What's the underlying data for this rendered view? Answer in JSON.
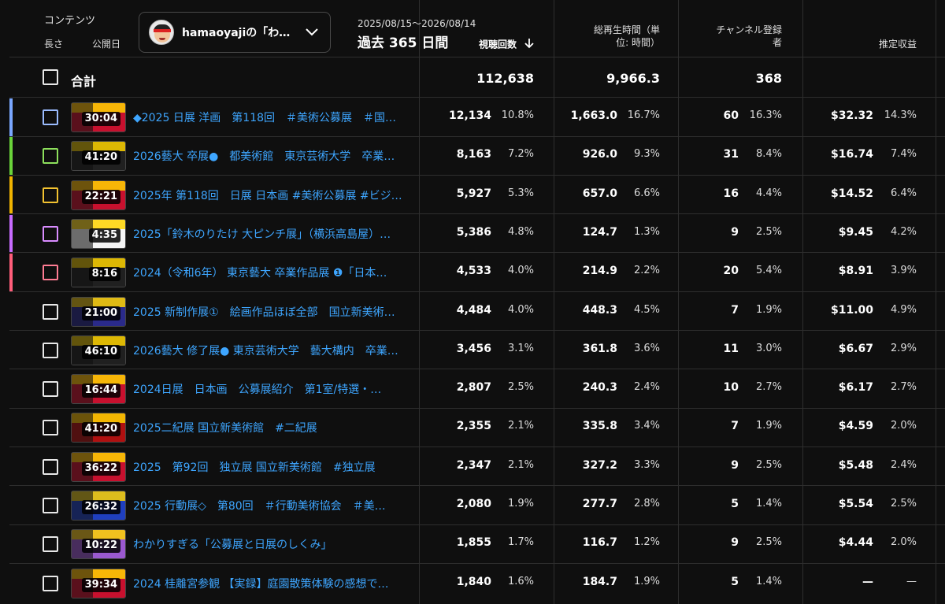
{
  "header": {
    "content_label": "コンテンツ",
    "length_label": "長さ",
    "published_label": "公開日",
    "channel_name": "hamaoyajiの「わ…",
    "date_range": "2025/08/15〜2026/08/14",
    "period": "過去 365 日間",
    "columns": {
      "views": "視聴回数",
      "watch_time_line1": "総再生時間（単",
      "watch_time_line2": "位: 時間）",
      "subs_line1": "チャンネル登録",
      "subs_line2": "者",
      "revenue": "推定収益"
    }
  },
  "totals": {
    "label": "合計",
    "views": "112,638",
    "watch_time": "9,966.3",
    "subscribers": "368",
    "revenue": ""
  },
  "colors": {
    "accent_link": "#3ea6ff",
    "background": "#0f0f0f"
  },
  "rows": [
    {
      "bar": "#7aa7ff",
      "box": "#9bbcff",
      "thumb": "#c8102e",
      "duration": "30:04",
      "title": "◆2025 日展 洋画　第118回　＃美術公募展　＃国…",
      "views": "12,134",
      "views_pct": "10.8%",
      "watch": "1,663.0",
      "watch_pct": "16.7%",
      "subs": "60",
      "subs_pct": "16.3%",
      "rev": "$32.32",
      "rev_pct": "14.3%"
    },
    {
      "bar": "#6ad43a",
      "box": "#8de05c",
      "thumb": "#202020",
      "duration": "41:20",
      "title": "2026藝大 卒展●　都美術館　東京芸術大学　卒業…",
      "views": "8,163",
      "views_pct": "7.2%",
      "watch": "926.0",
      "watch_pct": "9.3%",
      "subs": "31",
      "subs_pct": "8.4%",
      "rev": "$16.74",
      "rev_pct": "7.4%"
    },
    {
      "bar": "#f0b400",
      "box": "#f2c230",
      "thumb": "#c8102e",
      "duration": "22:21",
      "title": "2025年 第118回　日展 日本画 #美術公募展 #ビジ…",
      "views": "5,927",
      "views_pct": "5.3%",
      "watch": "657.0",
      "watch_pct": "6.6%",
      "subs": "16",
      "subs_pct": "4.4%",
      "rev": "$14.52",
      "rev_pct": "6.4%"
    },
    {
      "bar": "#c86bff",
      "box": "#d98cff",
      "thumb": "#f5f5f5",
      "duration": "4:35",
      "title": "2025「鈴木のりたけ 大ピンチ展」（横浜高島屋）…",
      "views": "5,386",
      "views_pct": "4.8%",
      "watch": "124.7",
      "watch_pct": "1.3%",
      "subs": "9",
      "subs_pct": "2.5%",
      "rev": "$9.45",
      "rev_pct": "4.2%"
    },
    {
      "bar": "#ff5d7a",
      "box": "#ff7c93",
      "thumb": "#202020",
      "duration": "8:16",
      "title": "2024（令和6年） 東京藝大 卒業作品展 ❶「日本…",
      "views": "4,533",
      "views_pct": "4.0%",
      "watch": "214.9",
      "watch_pct": "2.2%",
      "subs": "20",
      "subs_pct": "5.4%",
      "rev": "$8.91",
      "rev_pct": "3.9%"
    },
    {
      "bar": "",
      "box": "#e8e8e8",
      "thumb": "#2a2a8a",
      "duration": "21:00",
      "title": "2025 新制作展①　絵画作品ほぼ全部　国立新美術…",
      "views": "4,484",
      "views_pct": "4.0%",
      "watch": "448.3",
      "watch_pct": "4.5%",
      "subs": "7",
      "subs_pct": "1.9%",
      "rev": "$11.00",
      "rev_pct": "4.9%"
    },
    {
      "bar": "",
      "box": "#e8e8e8",
      "thumb": "#202020",
      "duration": "46:10",
      "title": "2026藝大 修了展● 東京芸術大学　藝大構内　卒業…",
      "views": "3,456",
      "views_pct": "3.1%",
      "watch": "361.8",
      "watch_pct": "3.6%",
      "subs": "11",
      "subs_pct": "3.0%",
      "rev": "$6.67",
      "rev_pct": "2.9%"
    },
    {
      "bar": "",
      "box": "#e8e8e8",
      "thumb": "#c8102e",
      "duration": "16:44",
      "title": "2024日展　日本画　公募展紹介　第1室/特選・…",
      "views": "2,807",
      "views_pct": "2.5%",
      "watch": "240.3",
      "watch_pct": "2.4%",
      "subs": "10",
      "subs_pct": "2.7%",
      "rev": "$6.17",
      "rev_pct": "2.7%"
    },
    {
      "bar": "",
      "box": "#e8e8e8",
      "thumb": "#b01010",
      "duration": "41:20",
      "title": "2025二紀展 国立新美術館　#二紀展",
      "views": "2,355",
      "views_pct": "2.1%",
      "watch": "335.8",
      "watch_pct": "3.4%",
      "subs": "7",
      "subs_pct": "1.9%",
      "rev": "$4.59",
      "rev_pct": "2.0%"
    },
    {
      "bar": "",
      "box": "#e8e8e8",
      "thumb": "#c8102e",
      "duration": "36:22",
      "title": "2025　第92回　独立展 国立新美術館　#独立展",
      "views": "2,347",
      "views_pct": "2.1%",
      "watch": "327.2",
      "watch_pct": "3.3%",
      "subs": "9",
      "subs_pct": "2.5%",
      "rev": "$5.48",
      "rev_pct": "2.4%"
    },
    {
      "bar": "",
      "box": "#e8e8e8",
      "thumb": "#1f3fbf",
      "duration": "26:32",
      "title": "2025 行動展◇　第80回　＃行動美術協会　＃美…",
      "views": "2,080",
      "views_pct": "1.9%",
      "watch": "277.7",
      "watch_pct": "2.8%",
      "subs": "5",
      "subs_pct": "1.4%",
      "rev": "$5.54",
      "rev_pct": "2.5%"
    },
    {
      "bar": "",
      "box": "#e8e8e8",
      "thumb": "#9b59d0",
      "duration": "10:22",
      "title": "わかりすぎる「公募展と日展のしくみ」",
      "views": "1,855",
      "views_pct": "1.7%",
      "watch": "116.7",
      "watch_pct": "1.2%",
      "subs": "9",
      "subs_pct": "2.5%",
      "rev": "$4.44",
      "rev_pct": "2.0%"
    },
    {
      "bar": "",
      "box": "#e8e8e8",
      "thumb": "#c8102e",
      "duration": "39:34",
      "title": "2024 桂離宮参観 【実録】庭園散策体験の感想で…",
      "views": "1,840",
      "views_pct": "1.6%",
      "watch": "184.7",
      "watch_pct": "1.9%",
      "subs": "5",
      "subs_pct": "1.4%",
      "rev": "—",
      "rev_pct": "—"
    }
  ]
}
